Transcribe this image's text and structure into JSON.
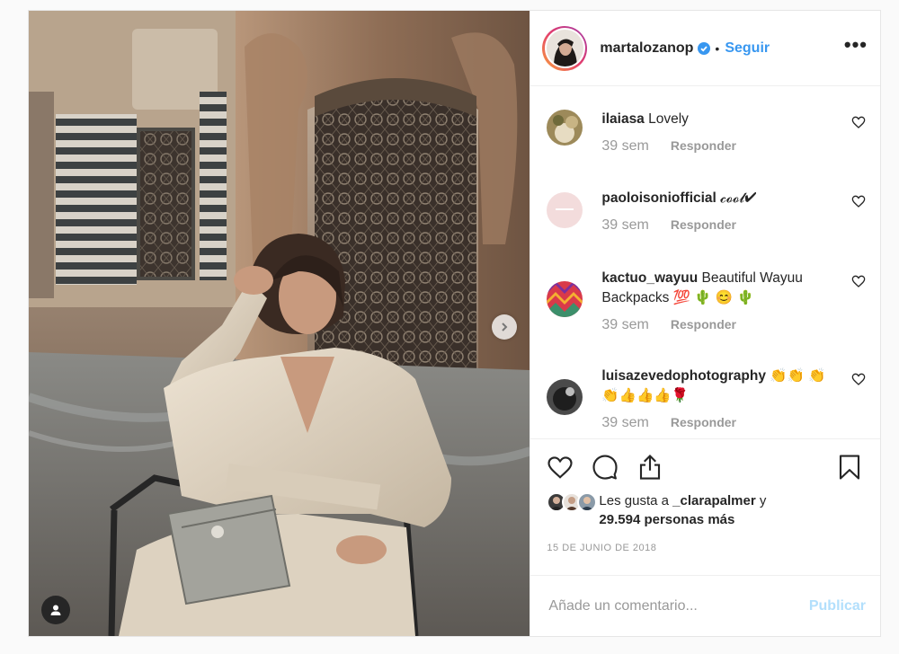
{
  "post": {
    "author": "martalozanop",
    "separator": "•",
    "follow_label": "Seguir",
    "more_label": "•••"
  },
  "comments": [
    {
      "user": "ilaiasa",
      "text": "Lovely",
      "time": "39 sem",
      "reply": "Responder"
    },
    {
      "user": "paoloisoniofficial",
      "text": "𝓬𝓸𝓸𝓵✔",
      "time": "39 sem",
      "reply": "Responder"
    },
    {
      "user": "kactuo_wayuu",
      "text": "Beautiful Wayuu Backpacks 💯 🌵 😊 🌵",
      "time": "39 sem",
      "reply": "Responder"
    },
    {
      "user": "luisazevedophotography",
      "text": "👏👏 👏👏👍👍👍🌹",
      "time": "39 sem",
      "reply": "Responder"
    }
  ],
  "likes": {
    "prefix": "Les gusta a",
    "user": "_clarapalmer",
    "conj": "y",
    "others": "29.594 personas más"
  },
  "date": "15 DE JUNIO DE 2018",
  "add_comment": {
    "placeholder": "Añade un comentario...",
    "publish_label": "Publicar"
  },
  "icons": {
    "verified": "verified-badge-icon",
    "like": "heart-icon",
    "comment": "comment-bubble-icon",
    "share": "share-upload-icon",
    "save": "bookmark-icon",
    "next": "chevron-right-icon",
    "tag": "user-tag-icon"
  },
  "colors": {
    "accent": "#3897f0",
    "publish_disabled": "#b2dffc",
    "muted": "#999999"
  }
}
